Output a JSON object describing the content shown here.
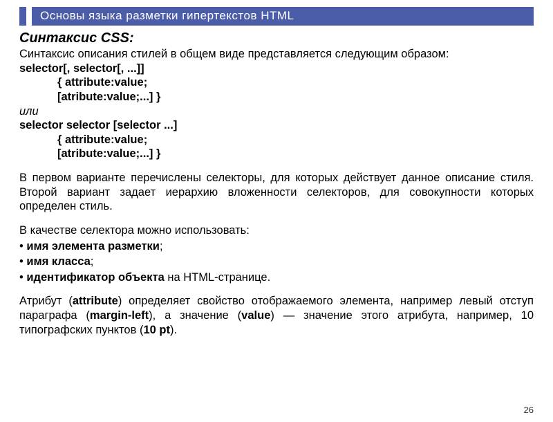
{
  "header": {
    "title": "Основы языка разметки гипертекстов HTML"
  },
  "heading": {
    "text": "Синтаксис CSS",
    "colon": ":"
  },
  "intro": "Синтаксис описания стилей в общем виде представляется следующим образом:",
  "syntax1": {
    "l1": "selector[, selector[, ...]]",
    "l2": "{ attribute:value;",
    "l3": "[atribute:value;...] }"
  },
  "or": "или",
  "syntax2": {
    "l1": "selector selector [selector ...]",
    "l2": "{ attribute:value;",
    "l3": "[atribute:value;...] }"
  },
  "para1": "В первом варианте перечислены селекторы, для которых действует данное описание стиля. Второй вариант задает иерархию вложенности селекторов, для совокупности которых определен стиль.",
  "list": {
    "intro": "В качестве селектора можно использовать:",
    "i1a": "• ",
    "i1b": "имя элемента разметки",
    "i1c": ";",
    "i2a": "• ",
    "i2b": "имя класса",
    "i2c": ";",
    "i3a": "• ",
    "i3b": "идентификатор объекта",
    "i3c": " на HTML-странице."
  },
  "para2": {
    "p1": "Атрибут (",
    "a1": "attribute",
    "p2": ") определяет свойство отображаемого элемента, например левый отступ параграфа (",
    "a2": "margin-left",
    "p3": "), а значение (",
    "a3": "value",
    "p4": ") — значение этого атрибута, например, 10 типографских пунктов (",
    "a4": "10 pt",
    "p5": ")."
  },
  "pagenum": "26"
}
